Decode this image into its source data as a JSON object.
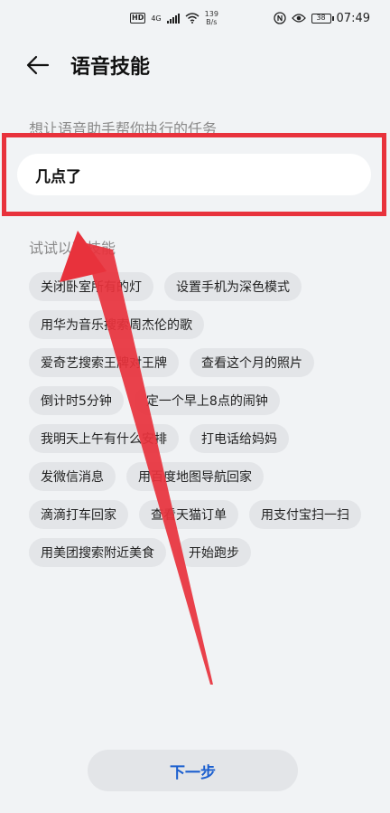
{
  "status_bar": {
    "hd": "HD",
    "network_type": "4G",
    "net_speed_value": "139",
    "net_speed_unit": "B/s",
    "battery": "38",
    "time": "07:49"
  },
  "header": {
    "title": "语音技能"
  },
  "task_section": {
    "label": "想让语音助手帮你执行的任务",
    "input_value": "几点了"
  },
  "suggestions": {
    "label": "试试以下技能",
    "chips": [
      "关闭卧室所有的灯",
      "设置手机为深色模式",
      "用华为音乐搜索周杰伦的歌",
      "爱奇艺搜索王牌对王牌",
      "查看这个月的照片",
      "倒计时5分钟",
      "定一个早上8点的闹钟",
      "我明天上午有什么安排",
      "打电话给妈妈",
      "发微信消息",
      "用百度地图导航回家",
      "滴滴打车回家",
      "查看天猫订单",
      "用支付宝扫一扫",
      "用美团搜索附近美食",
      "开始跑步"
    ]
  },
  "footer": {
    "next_label": "下一步"
  },
  "colors": {
    "highlight": "#e8323c",
    "accent_text": "#1b5fcf",
    "chip_bg": "#e3e5e8",
    "page_bg": "#f1f3f5"
  }
}
